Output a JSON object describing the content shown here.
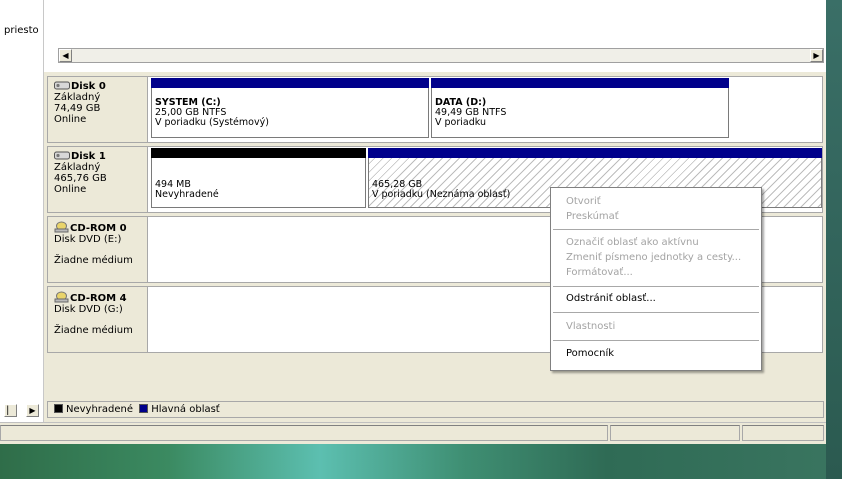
{
  "left_panel": {
    "label": "priesto"
  },
  "disks": [
    {
      "name": "Disk 0",
      "type": "Základný",
      "size": "74,49 GB",
      "status": "Online",
      "partitions": [
        {
          "title": "SYSTEM  (C:)",
          "detail": "25,00 GB NTFS",
          "state": "V poriadku (Systémový)"
        },
        {
          "title": "DATA  (D:)",
          "detail": "49,49 GB NTFS",
          "state": "V poriadku"
        }
      ]
    },
    {
      "name": "Disk 1",
      "type": "Základný",
      "size": "465,76 GB",
      "status": "Online",
      "partitions": [
        {
          "title": "",
          "detail": "494 MB",
          "state": "Nevyhradené"
        },
        {
          "title": "",
          "detail": "465,28 GB",
          "state": "V poriadku (Neznáma oblasť)"
        }
      ]
    },
    {
      "name": "CD-ROM 0",
      "type": "Disk DVD (E:)",
      "status": "Žiadne médium"
    },
    {
      "name": "CD-ROM 4",
      "type": "Disk DVD (G:)",
      "status": "Žiadne médium"
    }
  ],
  "legend": {
    "unallocated": "Nevyhradené",
    "primary": "Hlavná oblasť"
  },
  "context_menu": {
    "open": "Otvoriť",
    "explore": "Preskúmať",
    "mark_active": "Označiť oblasť ako aktívnu",
    "change_letter": "Zmeniť písmeno jednotky a cesty...",
    "format": "Formátovať...",
    "delete": "Odstrániť oblasť...",
    "properties": "Vlastnosti",
    "help": "Pomocník"
  },
  "colors": {
    "primary": "#00008b",
    "unallocated": "#000000"
  }
}
